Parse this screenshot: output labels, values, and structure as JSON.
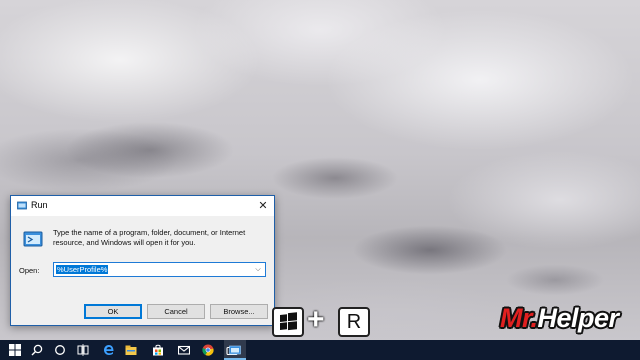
{
  "run_dialog": {
    "title": "Run",
    "close_glyph": "✕",
    "description": "Type the name of a program, folder, document, or Internet resource, and Windows will open it for you.",
    "open_label": "Open:",
    "open_value": "%UserProfile%",
    "ok_label": "OK",
    "cancel_label": "Cancel",
    "browse_label": "Browse..."
  },
  "shortcut": {
    "plus": "+",
    "key_r": "R"
  },
  "watermark": {
    "part1": "Mr.",
    "part2": "Helper"
  },
  "taskbar": {
    "items": [
      "windows-start-icon",
      "search-icon",
      "cortana-icon",
      "task-view-icon",
      "edge-icon",
      "file-explorer-icon",
      "store-icon",
      "mail-icon",
      "chrome-icon",
      "camera-icon",
      "run-icon"
    ]
  },
  "colors": {
    "accent": "#0078d7",
    "taskbar": "#0e1a30",
    "watermark_red": "#e02020"
  }
}
